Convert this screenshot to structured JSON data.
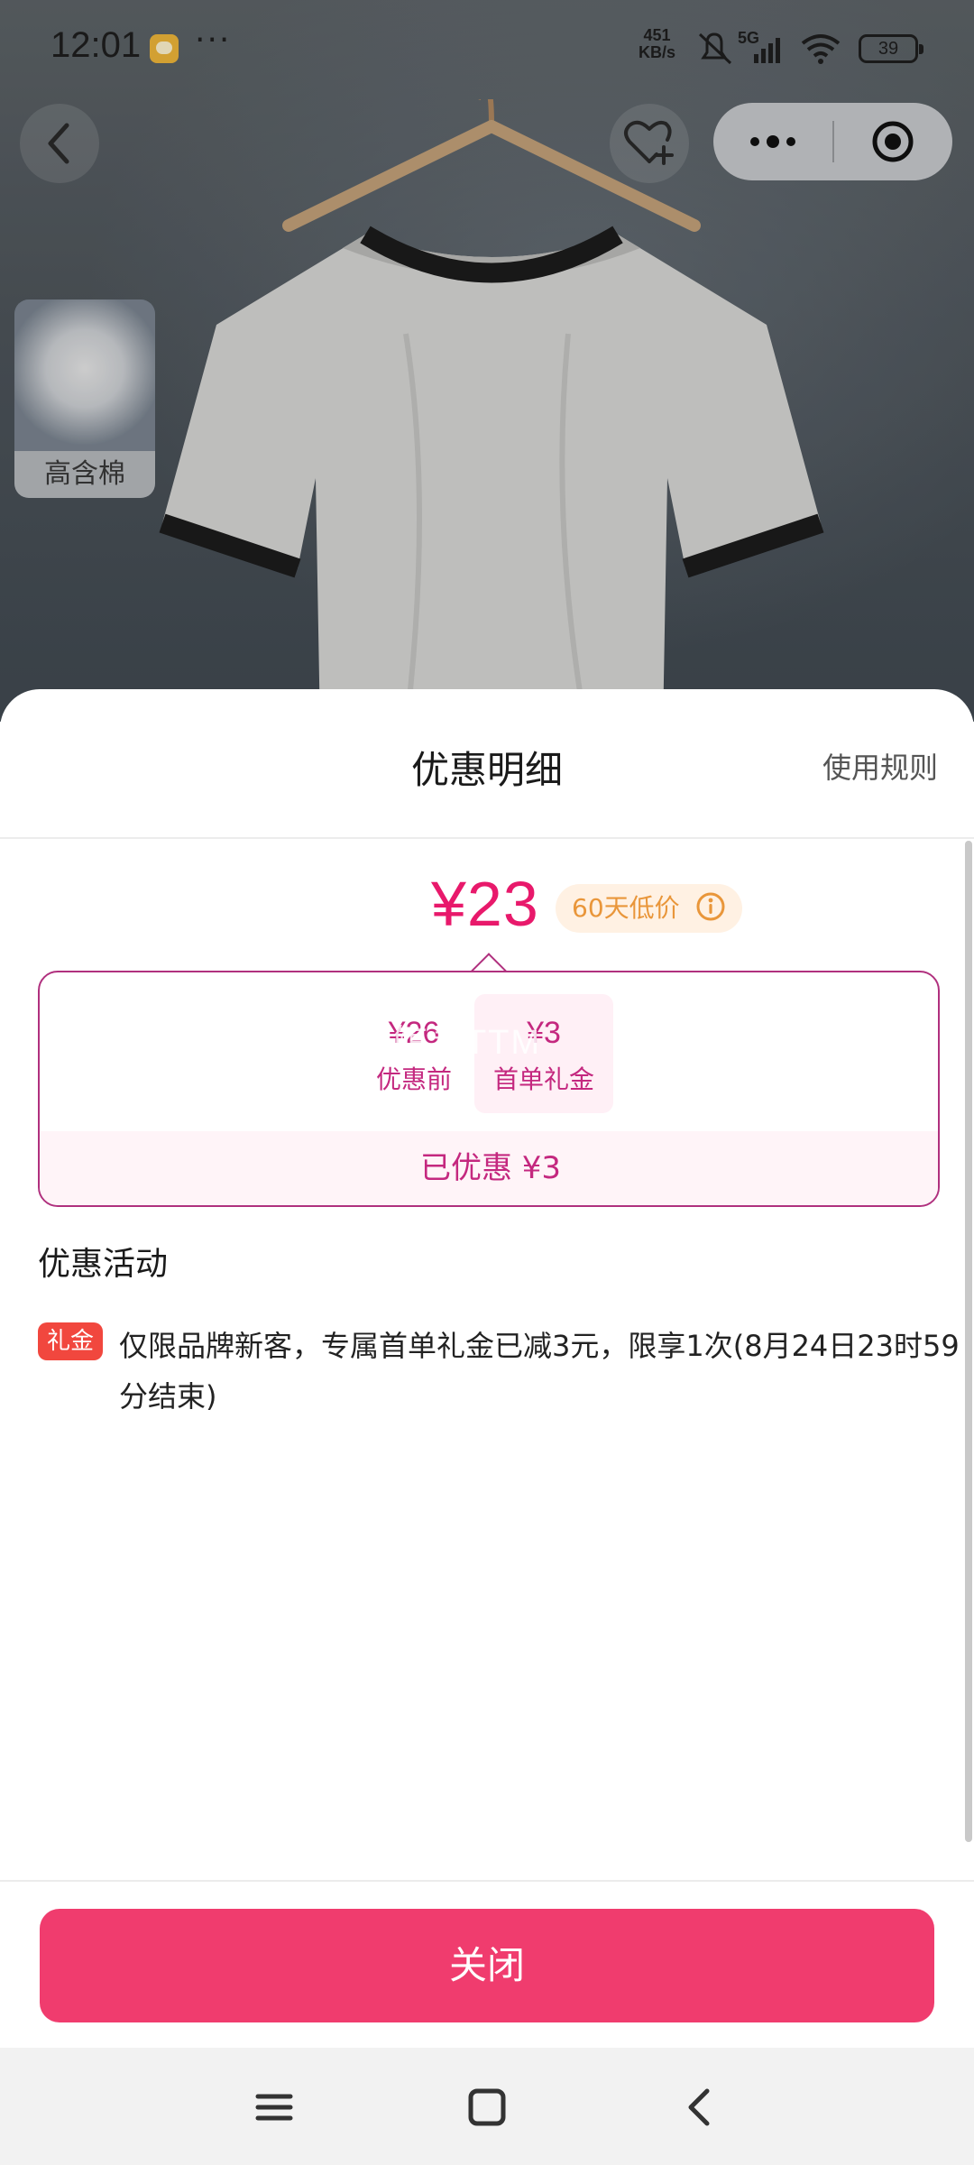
{
  "status_bar": {
    "time": "12:01",
    "more": "···",
    "net_speed_value": "451",
    "net_speed_unit": "KB/s",
    "network": "5G",
    "battery": "39"
  },
  "product": {
    "badge_label": "高含棉"
  },
  "sheet": {
    "title": "优惠明细",
    "rules_link": "使用规则",
    "final_price": "¥23",
    "price_tag": "60天低价",
    "breakdown": {
      "before": {
        "amount": "¥26",
        "label": "优惠前"
      },
      "coupon": {
        "amount": "¥3",
        "label": "首单礼金"
      },
      "watermark": "蓝鲸灵TTM",
      "saved": "已优惠 ¥3"
    },
    "activities_title": "优惠活动",
    "activity": {
      "badge": "礼金",
      "text": "仅限品牌新客，专属首单礼金已减3元，限享1次(8月24日23时59分结束)"
    },
    "close_button": "关闭"
  },
  "colors": {
    "accent": "#e8196b",
    "button": "#f03c6e",
    "tag_text": "#e9963a",
    "gift_badge": "#f1473e"
  },
  "icons": [
    "back-icon",
    "favorite-add-icon",
    "more-icon",
    "record-icon",
    "info-icon",
    "menu-icon",
    "home-icon",
    "nav-back-icon"
  ]
}
